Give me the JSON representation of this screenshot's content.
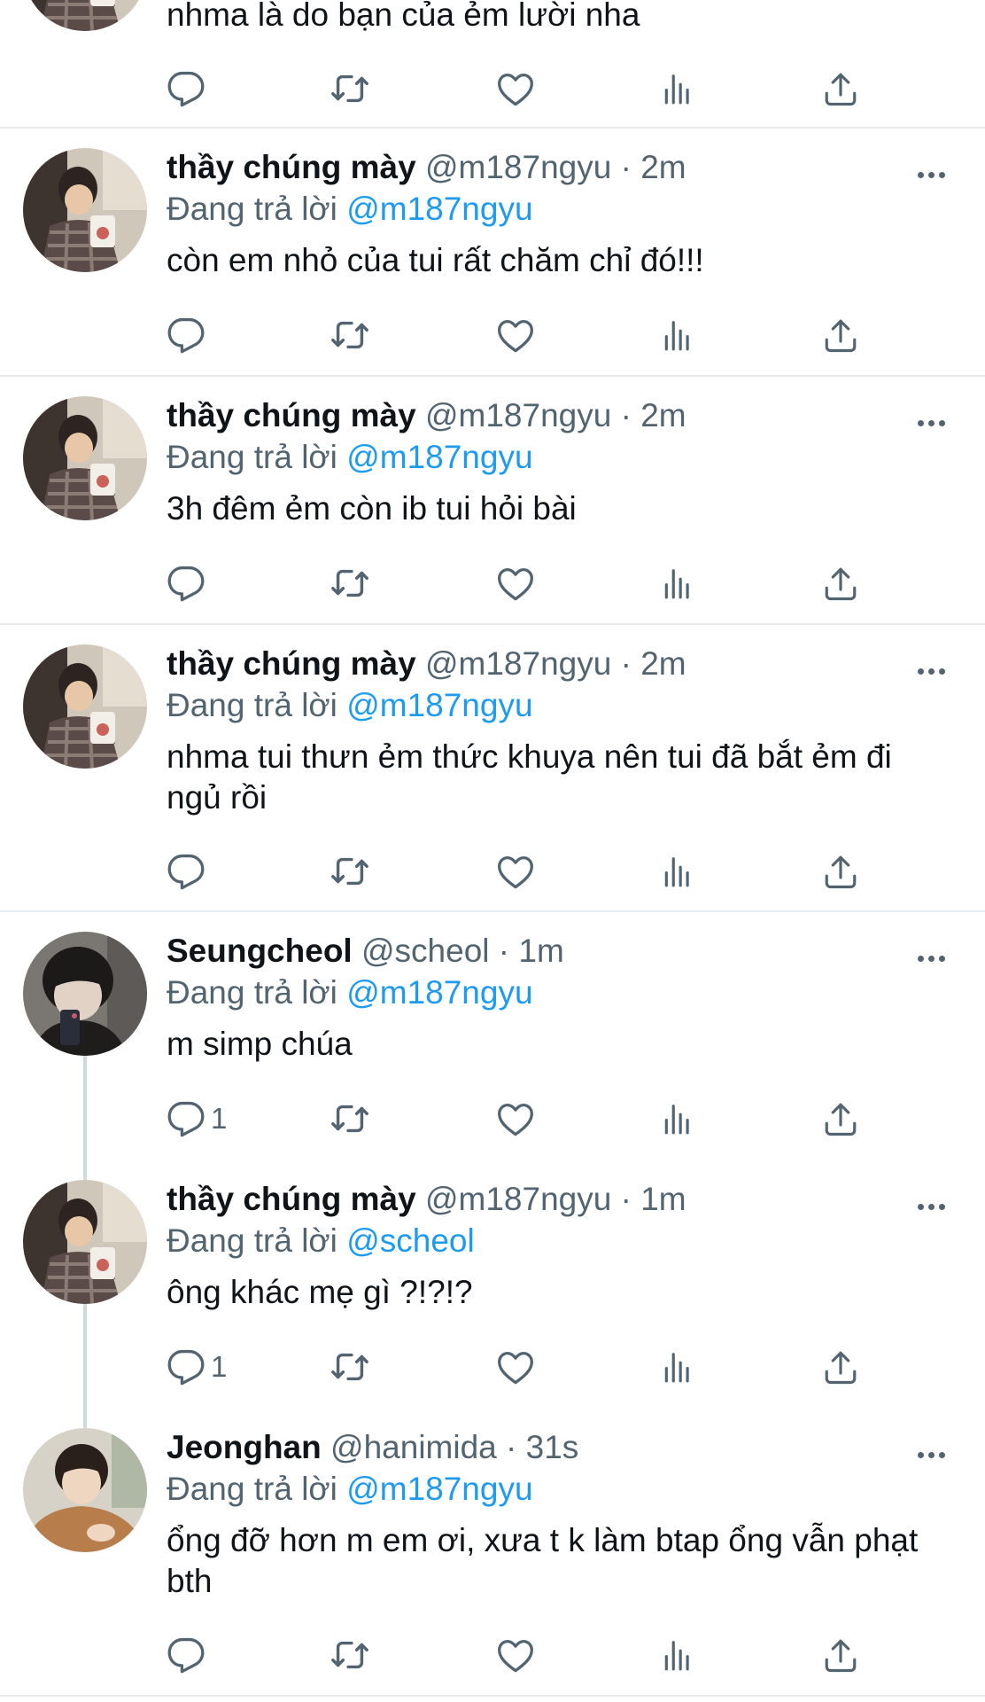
{
  "colors": {
    "text": "#0f1419",
    "secondary": "#536471",
    "accent": "#1d9bf0",
    "separator": "#e8ebee"
  },
  "icons": [
    "reply-icon",
    "retweet-icon",
    "like-icon",
    "analytics-icon",
    "share-icon",
    "more-icon"
  ],
  "top": {
    "body": "nhma là do bạn của ẻm lười nha"
  },
  "tweets": [
    {
      "name": "thầy chúng mày",
      "handle": "@m187ngyu",
      "time": "· 2m",
      "reply_prefix": "Đang trả lời",
      "reply_to": "@m187ngyu",
      "body": "còn em nhỏ của tui rất chăm chỉ đó!!!",
      "reply_count": ""
    },
    {
      "name": "thầy chúng mày",
      "handle": "@m187ngyu",
      "time": "· 2m",
      "reply_prefix": "Đang trả lời",
      "reply_to": "@m187ngyu",
      "body": "3h đêm ẻm còn ib tui hỏi bài",
      "reply_count": ""
    },
    {
      "name": "thầy chúng mày",
      "handle": "@m187ngyu",
      "time": "· 2m",
      "reply_prefix": "Đang trả lời",
      "reply_to": "@m187ngyu",
      "body": "nhma tui thưn ẻm thức khuya nên tui đã bắt ẻm đi ngủ rồi",
      "reply_count": ""
    },
    {
      "name": "Seungcheol",
      "handle": "@scheol",
      "time": "· 1m",
      "reply_prefix": "Đang trả lời",
      "reply_to": "@m187ngyu",
      "body": "m simp chúa",
      "reply_count": "1"
    },
    {
      "name": "thầy chúng mày",
      "handle": "@m187ngyu",
      "time": "· 1m",
      "reply_prefix": "Đang trả lời",
      "reply_to": "@scheol",
      "body": "ông khác mẹ gì ?!?!?",
      "reply_count": "1"
    },
    {
      "name": "Jeonghan",
      "handle": "@hanimida",
      "time": "· 31s",
      "reply_prefix": "Đang trả lời",
      "reply_to": "@m187ngyu",
      "body": "ổng đỡ hơn m em ơi, xưa t k làm btap ổng vẫn phạt bth",
      "reply_count": ""
    }
  ]
}
